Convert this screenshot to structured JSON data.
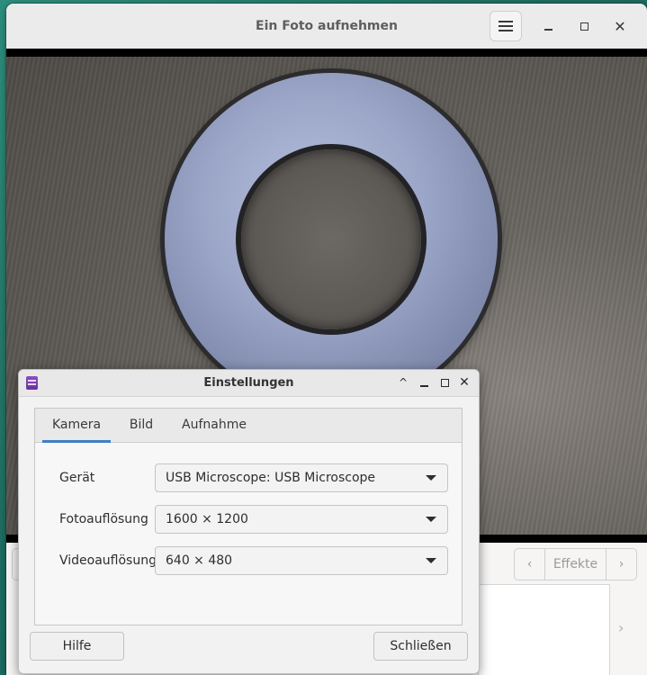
{
  "main_window": {
    "title": "Ein Foto aufnehmen",
    "effects_label": "Effekte",
    "prev_glyph": "‹",
    "next_glyph": "›",
    "gallery_next_glyph": "›",
    "close_glyph": "✕",
    "icons": [
      "menu-icon",
      "minimize-icon",
      "maximize-icon",
      "close-icon"
    ]
  },
  "dialog": {
    "title": "Einstellungen",
    "up_glyph": "^",
    "close_glyph": "✕",
    "tabs": [
      {
        "label": "Kamera",
        "active": true
      },
      {
        "label": "Bild",
        "active": false
      },
      {
        "label": "Aufnahme",
        "active": false
      }
    ],
    "fields": {
      "device": {
        "label": "Gerät",
        "value": "USB Microscope: USB Microscope"
      },
      "photo_resolution": {
        "label": "Fotoauflösung",
        "value": "1600 × 1200"
      },
      "video_resolution": {
        "label": "Videoauflösung",
        "value": "640 × 480"
      }
    },
    "buttons": {
      "help": "Hilfe",
      "close": "Schließen"
    },
    "accent_color": "#3d7fc4"
  }
}
